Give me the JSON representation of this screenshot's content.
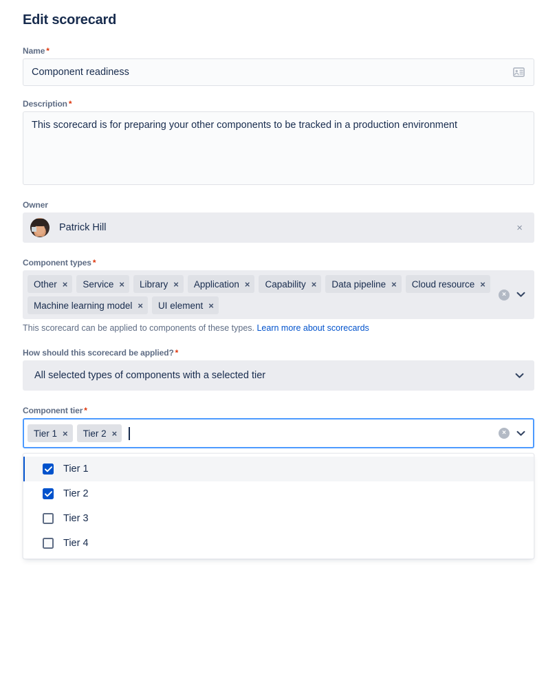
{
  "page": {
    "title": "Edit scorecard"
  },
  "name_field": {
    "label": "Name",
    "required": "*",
    "value": "Component readiness",
    "icon": "id-card-icon"
  },
  "description_field": {
    "label": "Description",
    "required": "*",
    "value": "This scorecard is for preparing your other components to be tracked in a production environment"
  },
  "owner_field": {
    "label": "Owner",
    "value": "Patrick Hill",
    "clear_label": "×",
    "avatar": "user-avatar"
  },
  "component_types": {
    "label": "Component types",
    "required": "*",
    "tags": [
      {
        "label": "Other",
        "remove": "×"
      },
      {
        "label": "Service",
        "remove": "×"
      },
      {
        "label": "Library",
        "remove": "×"
      },
      {
        "label": "Application",
        "remove": "×"
      },
      {
        "label": "Capability",
        "remove": "×"
      },
      {
        "label": "Data pipeline",
        "remove": "×"
      },
      {
        "label": "Cloud resource",
        "remove": "×"
      },
      {
        "label": "Machine learning model",
        "remove": "×"
      },
      {
        "label": "UI element",
        "remove": "×"
      }
    ],
    "clear_all": "×",
    "help_text": "This scorecard can be applied to components of these types.",
    "help_link": "Learn more about scorecards"
  },
  "applied_field": {
    "label": "How should this scorecard be applied?",
    "required": "*",
    "value": "All selected types of components with a selected tier"
  },
  "component_tier": {
    "label": "Component tier",
    "required": "*",
    "tags": [
      {
        "label": "Tier 1",
        "remove": "×"
      },
      {
        "label": "Tier 2",
        "remove": "×"
      }
    ],
    "clear_all": "×",
    "options": [
      {
        "label": "Tier 1",
        "checked": true,
        "highlighted": true
      },
      {
        "label": "Tier 2",
        "checked": true,
        "highlighted": false
      },
      {
        "label": "Tier 3",
        "checked": false,
        "highlighted": false
      },
      {
        "label": "Tier 4",
        "checked": false,
        "highlighted": false
      }
    ]
  },
  "colors": {
    "accent_blue": "#0052CC",
    "focus_blue": "#4C9AFF",
    "text_dark": "#172B4D",
    "label_gray": "#5E6C84",
    "required_red": "#DE350B",
    "field_bg": "#EBECF0",
    "input_bg": "#FAFBFC",
    "tag_bg": "#DFE1E6"
  }
}
